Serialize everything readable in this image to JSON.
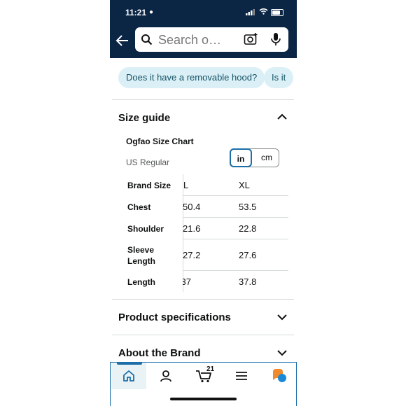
{
  "status_bar": {
    "time": "11:21"
  },
  "search": {
    "placeholder": "Search o…"
  },
  "chips": [
    "Does it have a removable hood?",
    "Is it"
  ],
  "size_guide": {
    "title": "Size guide",
    "chart_title": "Ogfao Size Chart",
    "region": "US Regular",
    "units": {
      "in": "in",
      "cm": "cm",
      "selected": "in"
    },
    "header": {
      "label": "Brand Size",
      "col1": "L",
      "col2": "XL"
    },
    "rows": [
      {
        "label": "Chest",
        "col1": "50.4",
        "col2": "53.5"
      },
      {
        "label": "Shoulder",
        "col1": "21.6",
        "col2": "22.8"
      },
      {
        "label": "Sleeve Length",
        "col1": "27.2",
        "col2": "27.6"
      },
      {
        "label": "Length",
        "col1": "37",
        "col2": "37.8"
      }
    ]
  },
  "sections": {
    "specs": "Product specifications",
    "brand": "About the Brand"
  },
  "bottom_nav": {
    "cart_count": "21"
  },
  "colors": {
    "header_bg": "#0b2545",
    "chip_bg": "#daf0f6",
    "accent": "#1b6ea8"
  }
}
